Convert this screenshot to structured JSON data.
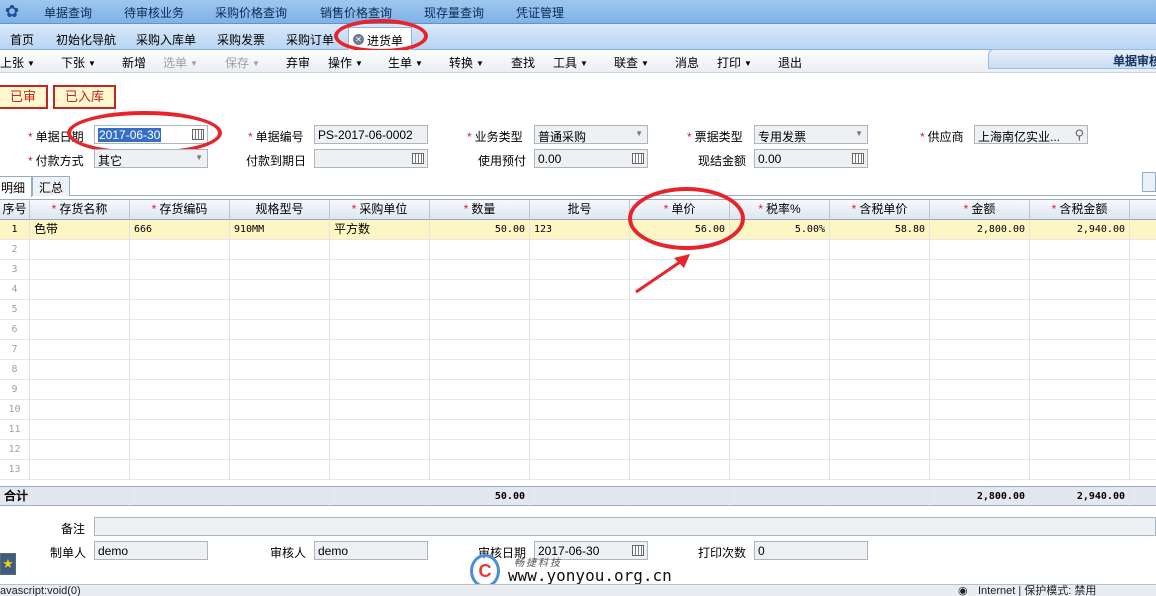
{
  "top_menu": [
    "单据查询",
    "待审核业务",
    "采购价格查询",
    "销售价格查询",
    "现存量查询",
    "凭证管理"
  ],
  "tabs": [
    {
      "label": "首页"
    },
    {
      "label": "初始化导航"
    },
    {
      "label": "采购入库单"
    },
    {
      "label": "采购发票"
    },
    {
      "label": "采购订单"
    },
    {
      "label": "进货单"
    }
  ],
  "toolbar": {
    "prev": "上张",
    "next": "下张",
    "add": "新增",
    "select": "选单",
    "save": "保存",
    "abandon": "弃审",
    "operate": "操作",
    "generate": "生单",
    "convert": "转换",
    "find": "查找",
    "tools": "工具",
    "query": "联查",
    "message": "消息",
    "print": "打印",
    "exit": "退出"
  },
  "panel_title": "单据审核",
  "status": {
    "audited": "已审",
    "stocked": "已入库"
  },
  "form": {
    "date_label": "单据日期",
    "date_value": "2017-06-30",
    "code_label": "单据编号",
    "code_value": "PS-2017-06-0002",
    "biz_type_label": "业务类型",
    "biz_type_value": "普通采购",
    "invoice_type_label": "票据类型",
    "invoice_type_value": "专用发票",
    "supplier_label": "供应商",
    "supplier_value": "上海南亿实业...",
    "pay_method_label": "付款方式",
    "pay_method_value": "其它",
    "due_label": "付款到期日",
    "due_value": "",
    "prepay_label": "使用预付",
    "prepay_value": "0.00",
    "cash_label": "现结金额",
    "cash_value": "0.00"
  },
  "subtabs": [
    "明细",
    "汇总"
  ],
  "grid": {
    "headers": [
      {
        "text": "序号",
        "req": false
      },
      {
        "text": "存货名称",
        "req": true
      },
      {
        "text": "存货编码",
        "req": true
      },
      {
        "text": "规格型号",
        "req": false
      },
      {
        "text": "采购单位",
        "req": true
      },
      {
        "text": "数量",
        "req": true
      },
      {
        "text": "批号",
        "req": false
      },
      {
        "text": "单价",
        "req": true
      },
      {
        "text": "税率%",
        "req": true
      },
      {
        "text": "含税单价",
        "req": true
      },
      {
        "text": "金额",
        "req": true
      },
      {
        "text": "含税金额",
        "req": true
      }
    ],
    "rows": [
      {
        "no": "1",
        "name": "色带",
        "code": "666",
        "spec": "910MM",
        "unit": "平方数",
        "qty": "50.00",
        "batch": "123",
        "price": "56.00",
        "tax": "5.00%",
        "taxprice": "58.80",
        "amount": "2,800.00",
        "taxamount": "2,940.00"
      }
    ],
    "empty_rows": [
      "2",
      "3",
      "4",
      "5",
      "6",
      "7",
      "8",
      "9",
      "10",
      "11",
      "12",
      "13"
    ],
    "total": {
      "label": "合计",
      "qty": "50.00",
      "amount": "2,800.00",
      "taxamount": "2,940.00"
    }
  },
  "footer": {
    "remark_label": "备注",
    "maker_label": "制单人",
    "maker_value": "demo",
    "auditor_label": "审核人",
    "auditor_value": "demo",
    "audit_date_label": "审核日期",
    "audit_date_value": "2017-06-30",
    "print_count_label": "打印次数",
    "print_count_value": "0"
  },
  "statusbar": {
    "left": "avascript:void(0)",
    "right": "Internet | 保护模式: 禁用"
  },
  "watermark": {
    "url": "www.yonyou.org.cn",
    "cn": "畅捷科技"
  }
}
